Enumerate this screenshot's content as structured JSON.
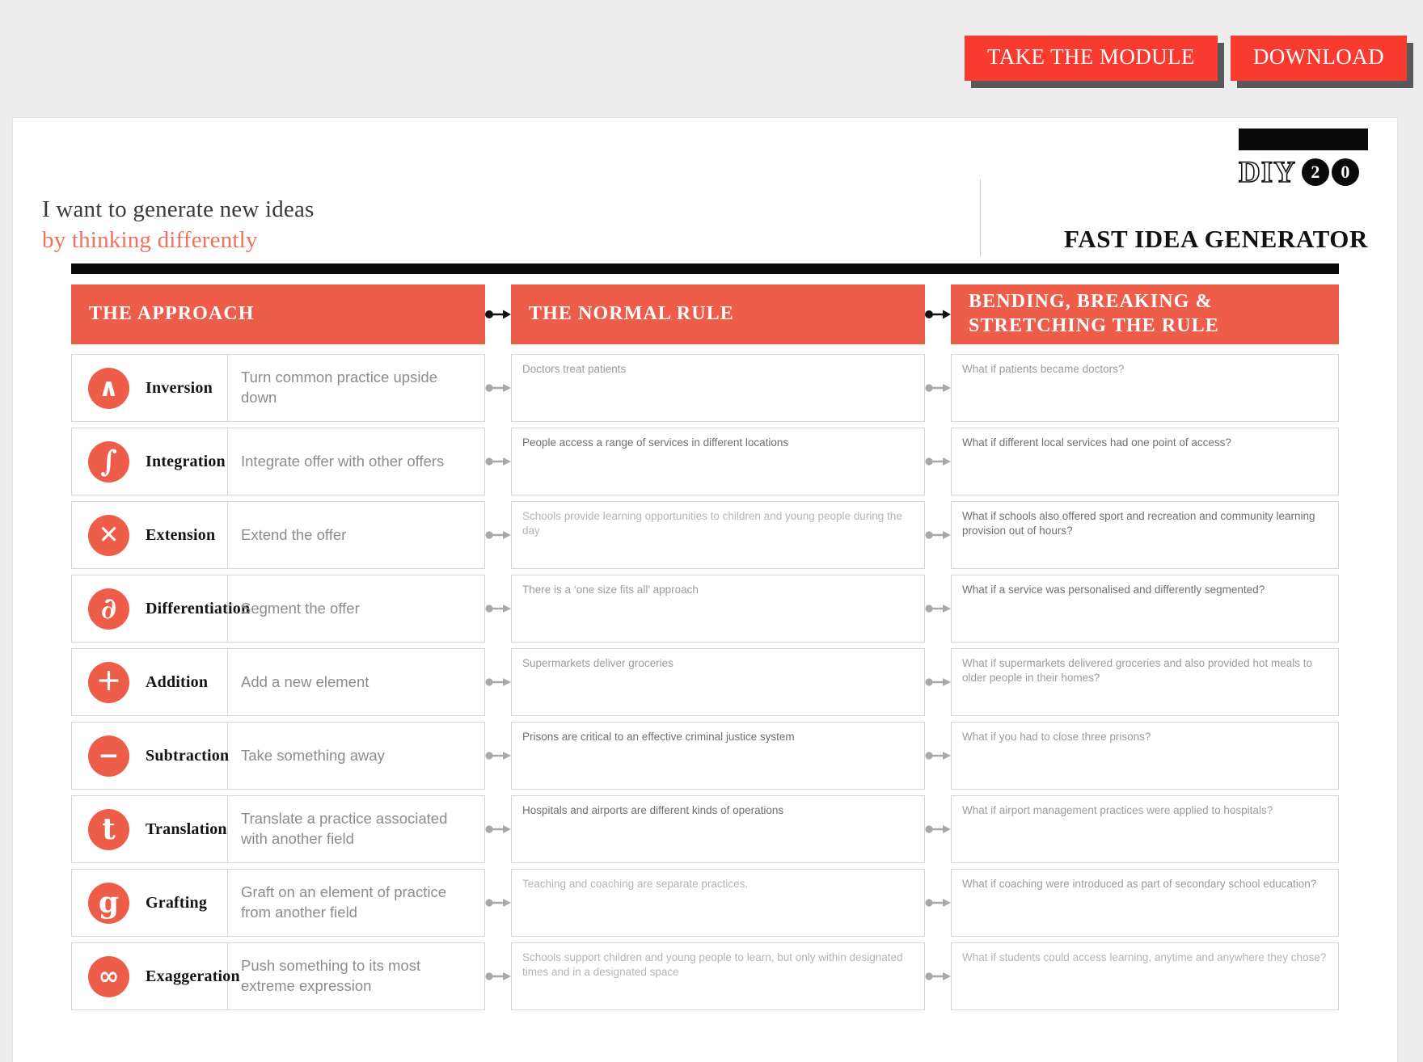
{
  "topbar": {
    "buttons": [
      {
        "label": "TAKE THE MODULE",
        "name": "take-the-module-button"
      },
      {
        "label": "DOWNLOAD",
        "name": "download-button"
      }
    ]
  },
  "logo": {
    "wordmark": "DIY",
    "badge_two": "2",
    "badge_zero": "0"
  },
  "header": {
    "line1": "I want to generate new ideas",
    "line2": "by thinking differently",
    "doc_title": "FAST IDEA GENERATOR"
  },
  "columns": {
    "approach": "THE APPROACH",
    "normal_rule": "THE NORMAL RULE",
    "bending": "BENDING, BREAKING &\nSTRETCHING THE RULE",
    "bending_line1": "BENDING, BREAKING &",
    "bending_line2": "STRETCHING THE RULE"
  },
  "colors": {
    "coral": "#ee5d49",
    "cta_red": "#f93a2f",
    "shadow_grey": "#59595b",
    "heading_red": "#f07060",
    "border_grey": "#d6d6d6"
  },
  "rows": [
    {
      "icon": "caret-up-icon",
      "glyph": "∧",
      "name": "Inversion",
      "description": "Turn common practice upside down",
      "normal_rule": "Doctors treat patients",
      "bending": "What if patients became doctors?",
      "rule_tone": "mid",
      "bend_tone": "mid"
    },
    {
      "icon": "integral-icon",
      "glyph": "∫",
      "name": "Integration",
      "description": " Integrate offer with other offers",
      "normal_rule": "People access a range of services in different locations",
      "bending": "What if different local services had one point of access?",
      "rule_tone": "dark",
      "bend_tone": "dark"
    },
    {
      "icon": "multiply-icon",
      "glyph": "✕",
      "name": "Extension",
      "description": "Extend the offer",
      "normal_rule": "Schools provide learning opportunities to children and young people during the day",
      "bending": "What if schools also offered sport and recreation and community learning provision out of hours?",
      "rule_tone": "light",
      "bend_tone": "dark"
    },
    {
      "icon": "partial-derivative-icon",
      "glyph": "∂",
      "name": "Differentiation",
      "description": "Segment the offer",
      "normal_rule": "There is a ‘one size fits all’ approach",
      "bending": "What if a service was personalised and differently segmented?",
      "rule_tone": "mid",
      "bend_tone": "dark"
    },
    {
      "icon": "plus-icon",
      "glyph": "＋",
      "name": "Addition",
      "description": "Add a new element",
      "normal_rule": "Supermarkets deliver groceries",
      "bending": "What if supermarkets delivered groceries and also provided hot meals to older people in their homes?",
      "rule_tone": "mid",
      "bend_tone": "mid"
    },
    {
      "icon": "minus-icon",
      "glyph": "−",
      "name": "Subtraction",
      "description": "Take something away",
      "normal_rule": "Prisons are critical to an effective criminal justice system",
      "bending": "What if you had to close three prisons?",
      "rule_tone": "dark",
      "bend_tone": "mid"
    },
    {
      "icon": "letter-t-icon",
      "glyph": "t",
      "name": "Translation",
      "description": "Translate a practice associated with another field",
      "normal_rule": "Hospitals and airports are different kinds of operations",
      "bending": "What if airport management practices were applied to hospitals?",
      "rule_tone": "dark",
      "bend_tone": "mid"
    },
    {
      "icon": "letter-g-icon",
      "glyph": "g",
      "name": "Grafting",
      "description": "Graft on an element of practice from another field",
      "normal_rule": "Teaching and coaching are separate practices.",
      "bending": "What if coaching were introduced as part of secondary school education?",
      "rule_tone": "light",
      "bend_tone": "mid"
    },
    {
      "icon": "infinity-icon",
      "glyph": "∞",
      "name": "Exaggeration",
      "description": "Push something to its most extreme expression",
      "normal_rule": "Schools support children and young people to learn,  but only within designated times and in a designated space",
      "bending": "What if students could access learning, anytime and anywhere they chose?",
      "rule_tone": "light",
      "bend_tone": "light"
    }
  ]
}
